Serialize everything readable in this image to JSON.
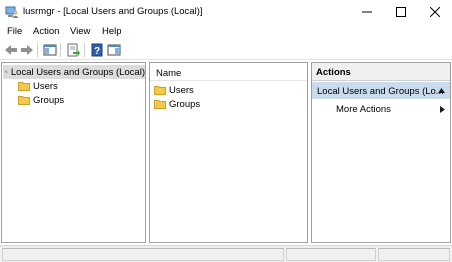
{
  "window": {
    "title": "lusrmgr - [Local Users and Groups (Local)]",
    "icon": "computer-users-icon",
    "controls": [
      "minimize-icon",
      "maximize-icon",
      "close-icon"
    ]
  },
  "menu": {
    "items": [
      "File",
      "Action",
      "View",
      "Help"
    ]
  },
  "toolbar": {
    "buttons": [
      "back-arrow-icon",
      "forward-arrow-icon",
      "show-hide-tree-icon",
      "export-list-icon",
      "help-icon",
      "show-hide-action-pane-icon"
    ]
  },
  "tree": {
    "root": "Local Users and Groups (Local)",
    "children": [
      "Users",
      "Groups"
    ]
  },
  "list": {
    "column_header": "Name",
    "rows": [
      "Users",
      "Groups"
    ]
  },
  "actions": {
    "header": "Actions",
    "section_title": "Local Users and Groups (Lo...",
    "items": [
      "More Actions"
    ]
  },
  "colors": {
    "selection": "#dcdcdc",
    "actions_section": "#c9dced",
    "folder": "#f2c94c"
  }
}
